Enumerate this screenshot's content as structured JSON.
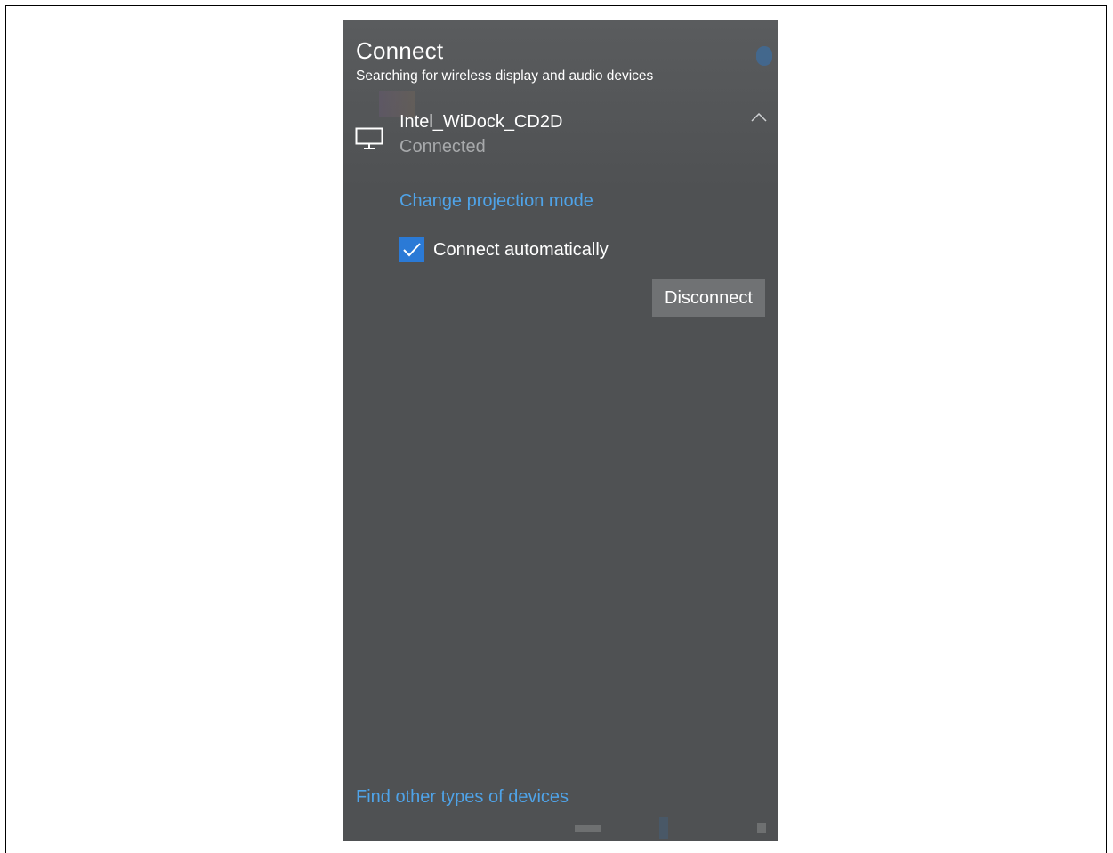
{
  "panel": {
    "title": "Connect",
    "subtitle": "Searching for wireless display and audio devices"
  },
  "device": {
    "icon": "monitor-icon",
    "name": "Intel_WiDock_CD2D",
    "status": "Connected",
    "expand_icon": "chevron-up-icon"
  },
  "actions": {
    "change_projection_label": "Change projection mode",
    "connect_automatically_label": "Connect automatically",
    "connect_automatically_checked": true,
    "disconnect_label": "Disconnect"
  },
  "footer": {
    "find_other_label": "Find other types of devices"
  },
  "colors": {
    "panel_bg": "#4f5153",
    "link": "#4fa3e8",
    "accent": "#2b7ad6",
    "button_bg": "#707274",
    "secondary_text": "#a7a9ab"
  }
}
